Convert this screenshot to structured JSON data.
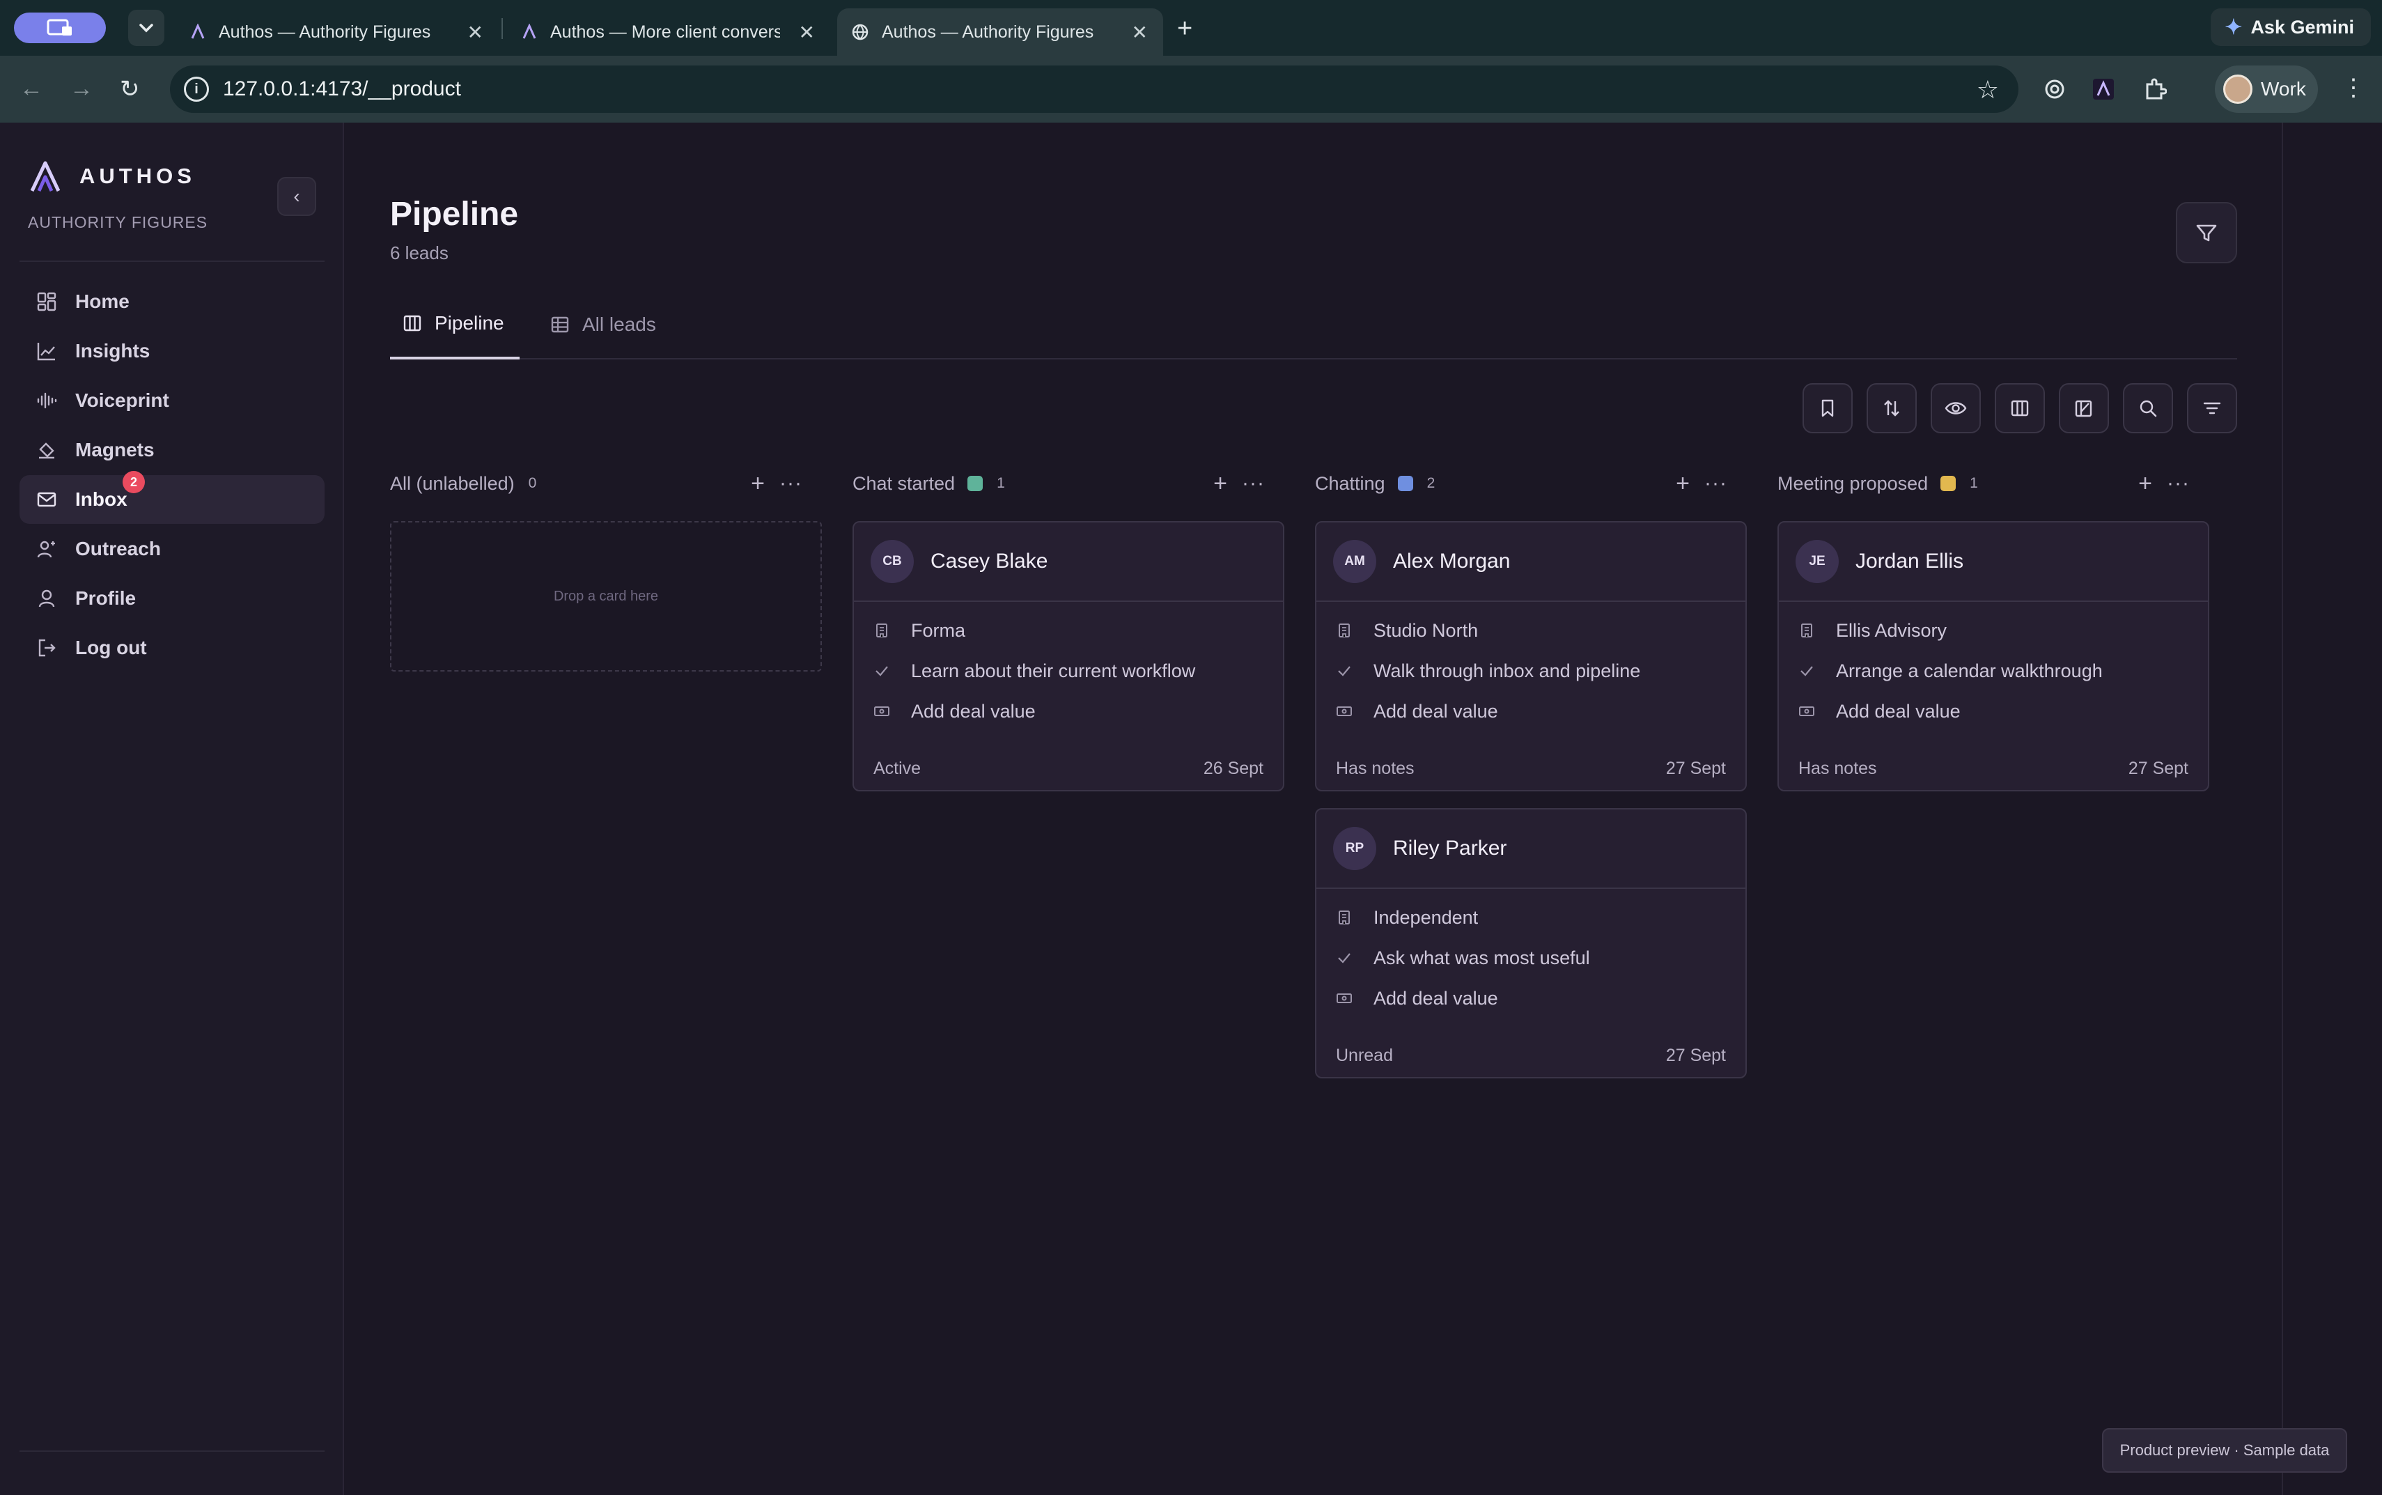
{
  "browser": {
    "tabs": [
      {
        "title": "Authos — Authority Figures",
        "active": false
      },
      {
        "title": "Authos — More client convers",
        "active": false
      },
      {
        "title": "Authos — Authority Figures",
        "active": true
      }
    ],
    "url": "127.0.0.1:4173/__product",
    "gemini_label": "Ask Gemini",
    "profile_label": "Work"
  },
  "sidebar": {
    "brand": "AUTHOS",
    "workspace": "AUTHORITY FIGURES",
    "items": [
      {
        "label": "Home",
        "icon": "grid-icon"
      },
      {
        "label": "Insights",
        "icon": "chart-line-icon"
      },
      {
        "label": "Voiceprint",
        "icon": "waveform-icon"
      },
      {
        "label": "Magnets",
        "icon": "magnet-icon"
      },
      {
        "label": "Inbox",
        "icon": "mail-icon",
        "badge": "2",
        "active": true
      },
      {
        "label": "Outreach",
        "icon": "user-plus-icon"
      },
      {
        "label": "Profile",
        "icon": "user-icon"
      },
      {
        "label": "Log out",
        "icon": "logout-icon"
      }
    ]
  },
  "page": {
    "title": "Pipeline",
    "subtitle": "6 leads",
    "tabs": [
      {
        "label": "Pipeline",
        "active": true
      },
      {
        "label": "All leads",
        "active": false
      }
    ]
  },
  "columns": [
    {
      "name": "All (unlabelled)",
      "count": "0",
      "color": "",
      "empty_text": "Drop a card here",
      "cards": []
    },
    {
      "name": "Chat started",
      "count": "1",
      "color": "#5fb39a",
      "cards": [
        {
          "initials": "CB",
          "name": "Casey Blake",
          "company": "Forma",
          "task": "Learn about their current workflow",
          "deal": "Add deal value",
          "status": "Active",
          "date": "26 Sept"
        }
      ]
    },
    {
      "name": "Chatting",
      "count": "2",
      "color": "#6f8fe0",
      "cards": [
        {
          "initials": "AM",
          "name": "Alex Morgan",
          "company": "Studio North",
          "task": "Walk through inbox and pipeline",
          "deal": "Add deal value",
          "status": "Has notes",
          "date": "27 Sept"
        },
        {
          "initials": "RP",
          "name": "Riley Parker",
          "company": "Independent",
          "task": "Ask what was most useful",
          "deal": "Add deal value",
          "status": "Unread",
          "date": "27 Sept"
        }
      ]
    },
    {
      "name": "Meeting proposed",
      "count": "1",
      "color": "#e2b84f",
      "cards": [
        {
          "initials": "JE",
          "name": "Jordan Ellis",
          "company": "Ellis Advisory",
          "task": "Arrange a calendar walkthrough",
          "deal": "Add deal value",
          "status": "Has notes",
          "date": "27 Sept"
        }
      ]
    }
  ],
  "footer": {
    "preview_label": "Product preview · Sample data"
  }
}
